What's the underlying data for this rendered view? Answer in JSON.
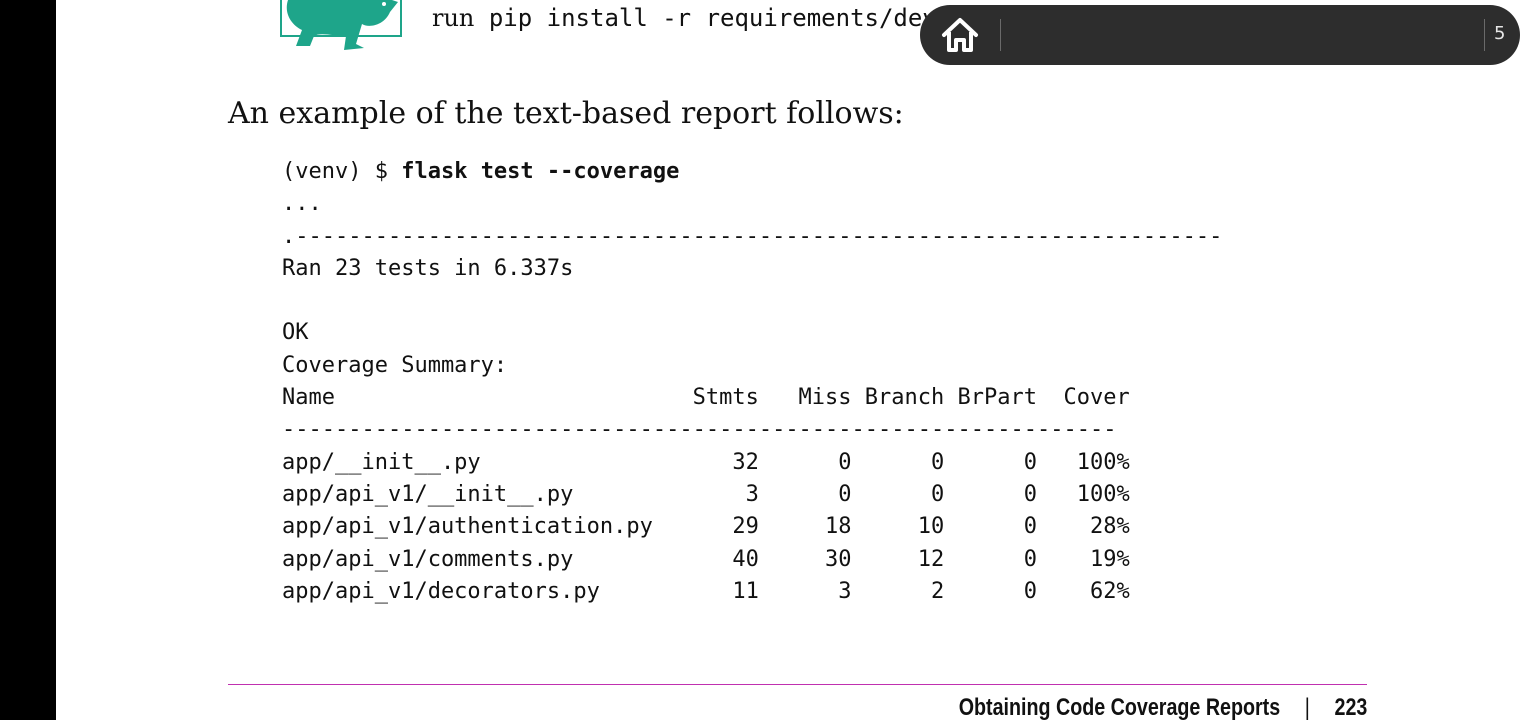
{
  "tip": {
    "prefix": "run",
    "command": "pip install -r requirements/dev.txt."
  },
  "intro": "An example of the text-based report follows:",
  "terminal": {
    "prompt": "(venv) $ ",
    "command": "flask test --coverage",
    "lines": [
      "...",
      ".----------------------------------------------------------------------",
      "Ran 23 tests in 6.337s",
      "",
      "OK",
      "Coverage Summary:",
      "Name                           Stmts   Miss Branch BrPart  Cover",
      "---------------------------------------------------------------",
      "app/__init__.py                   32      0      0      0   100%",
      "app/api_v1/__init__.py             3      0      0      0   100%",
      "app/api_v1/authentication.py      29     18     10      0    28%",
      "app/api_v1/comments.py            40     30     12      0    19%",
      "app/api_v1/decorators.py          11      3      2      0    62%"
    ]
  },
  "footer": {
    "section": "Obtaining Code Coverage Reports",
    "separator": "|",
    "page_number": "223"
  },
  "toolbar": {
    "home_icon": "home-icon",
    "page_indicator": "5"
  },
  "colors": {
    "tip_animal": "#1ea58a",
    "footer_rule": "#c030b0",
    "toolbar_bg": "#2d2d2d"
  }
}
